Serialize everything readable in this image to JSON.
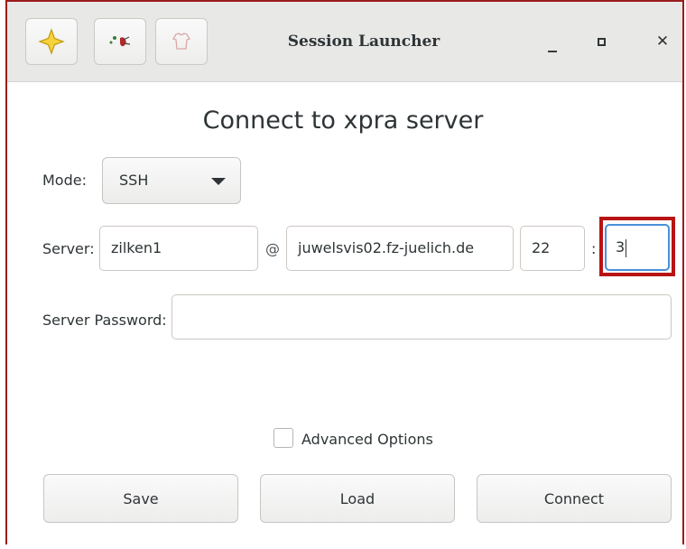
{
  "window": {
    "title": "Session Launcher",
    "minimize_glyph": "_",
    "maximize_glyph": "□",
    "close_glyph": "✕"
  },
  "toolbar_icons": [
    "star-icon",
    "bug-icon",
    "shirt-icon"
  ],
  "heading": "Connect to xpra server",
  "mode": {
    "label": "Mode:",
    "selected": "SSH"
  },
  "server": {
    "label": "Server:",
    "username": "zilken1",
    "at_sign": "@",
    "host": "juwelsvis02.fz-juelich.de",
    "port": "22",
    "colon": ":",
    "display": "3"
  },
  "password": {
    "label": "Server Password:",
    "value": ""
  },
  "advanced": {
    "label": "Advanced Options",
    "checked": false
  },
  "buttons": {
    "save": "Save",
    "load": "Load",
    "connect": "Connect"
  },
  "colors": {
    "highlight": "#b81414",
    "focus": "#4a90d9",
    "titlebar": "#e8e8e7"
  }
}
